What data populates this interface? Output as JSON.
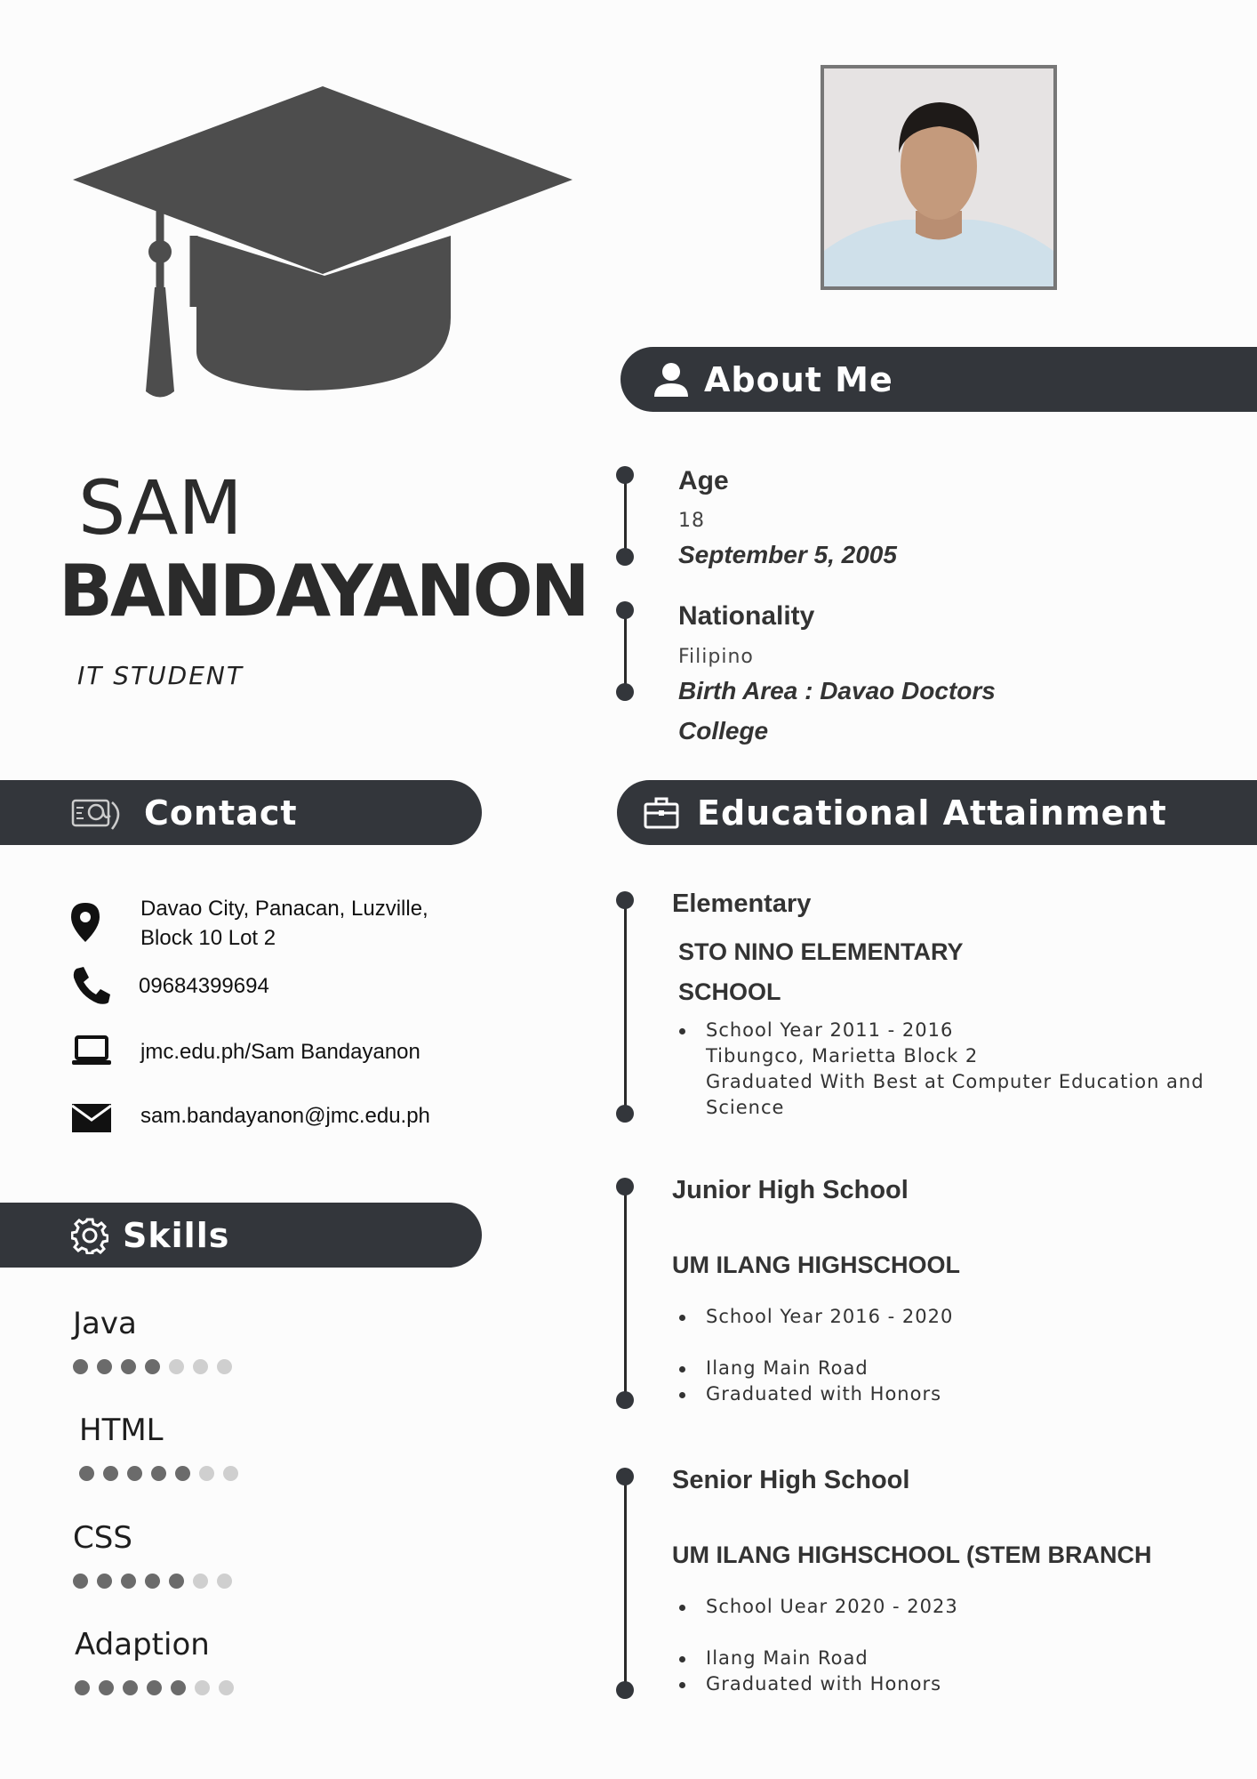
{
  "header": {
    "first_name": "SAM",
    "last_name": "BANDAYANON",
    "role": "IT STUDENT"
  },
  "about": {
    "title": "About Me",
    "age_label": "Age",
    "age_value": "18",
    "birthdate": "September 5, 2005",
    "nationality_label": "Nationality",
    "nationality_value": "Filipino",
    "birth_area_line1": "Birth Area : Davao Doctors",
    "birth_area_line2": "College"
  },
  "contact": {
    "title": "Contact",
    "address_line1": "Davao City, Panacan, Luzville,",
    "address_line2": "Block 10 Lot 2",
    "phone": "09684399694",
    "website": "jmc.edu.ph/Sam Bandayanon",
    "email": "sam.bandayanon@jmc.edu.ph"
  },
  "skills": {
    "title": "Skills",
    "items": [
      {
        "name": "Java",
        "level": 4,
        "max": 7
      },
      {
        "name": "HTML",
        "level": 5,
        "max": 7
      },
      {
        "name": "CSS",
        "level": 5,
        "max": 7
      },
      {
        "name": "Adaption",
        "level": 5,
        "max": 7
      }
    ]
  },
  "education": {
    "title": "Educational Attainment",
    "elementary": {
      "level": "Elementary",
      "school_line1": "STO NINO ELEMENTARY",
      "school_line2": "SCHOOL",
      "year": "School Year 2011 - 2016",
      "address": "Tibungco, Marietta Block 2",
      "award_line1": "Graduated With Best at Computer Education and",
      "award_line2": "Science"
    },
    "junior": {
      "level": "Junior High School",
      "school": "UM ILANG HIGHSCHOOL",
      "year": "School Year 2016 - 2020",
      "address": "Ilang Main Road",
      "award": "Graduated with Honors"
    },
    "senior": {
      "level": "Senior High School",
      "school": "UM ILANG HIGHSCHOOL (STEM BRANCH",
      "year": "School Uear 2020 - 2023",
      "address": "Ilang Main Road",
      "award": "Graduated with Honors"
    }
  },
  "colors": {
    "bar": "#33363b",
    "cap": "#4d4d4d",
    "dot_on": "#6b6b6b",
    "dot_off": "#cfcfcf"
  }
}
